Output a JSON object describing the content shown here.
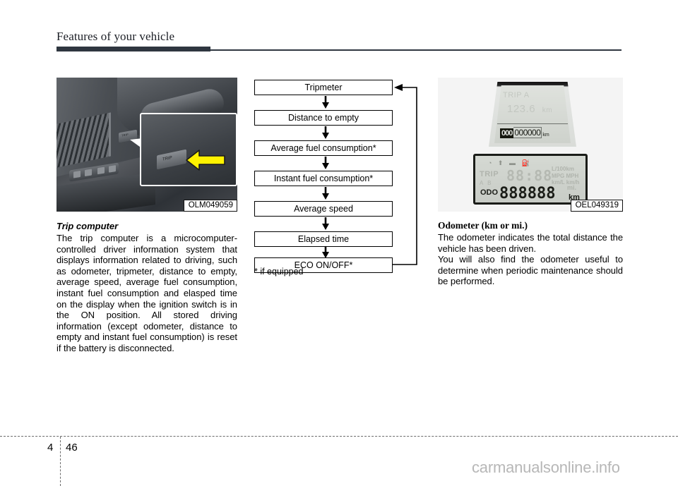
{
  "header": {
    "title": "Features of your vehicle"
  },
  "left_column": {
    "figure_code": "OLM049059",
    "photo_labels": {
      "button_label": "TRIP",
      "callout_button_label": "TRIP"
    },
    "sub_heading": "Trip computer",
    "paragraph": "The trip computer is a microcomputer-controlled driver information system that displays information related to driving, such as odometer, tripmeter, distance to empty, average speed, average fuel consumption, instant fuel consumption and elasped time on the display when the ignition switch is in the ON position. All stored driving information (except odometer, distance to empty and instant fuel consumption) is reset if the battery is disconnected."
  },
  "flowchart": {
    "steps": [
      "Tripmeter",
      "Distance to empty",
      "Average fuel consumption*",
      "Instant fuel consumption*",
      "Average speed",
      "Elapsed time",
      "ECO ON/OFF*"
    ],
    "footnote": "* if equipped",
    "loop_description": "loop-back-arrow-to-tripmeter"
  },
  "right_column": {
    "figure_code": "OEL049319",
    "cluster_top": {
      "trip_label": "TRIP A",
      "trip_value": "123.6",
      "trip_unit": "km",
      "odo_dark_digits": "000",
      "odo_light_digits": "000000",
      "odo_unit": "km"
    },
    "cluster_bottom": {
      "icons": "◔ ⬆ ▬ ⛽",
      "trip_label": "TRIP",
      "ab_label": "A B",
      "top_segments": "88:88",
      "unit_lines": "L/100km\nMPG MPH\nkm/L km/h",
      "odo_label": "ODO",
      "odo_segments": "888888",
      "odo_unit": "km",
      "mi_unit": "mi."
    },
    "heading": "Odometer (km or mi.)",
    "paragraph_1": "The odometer indicates the total distance the vehicle has been driven.",
    "paragraph_2": "You will also find the odometer useful to determine when periodic maintenance should be performed."
  },
  "footer": {
    "chapter": "4",
    "page": "46",
    "watermark": "carmanualsonline.info"
  },
  "colors": {
    "rule": "#2f3640",
    "text": "#000000",
    "watermark": "#b7b7b7",
    "callout_arrow": "#fff200"
  }
}
